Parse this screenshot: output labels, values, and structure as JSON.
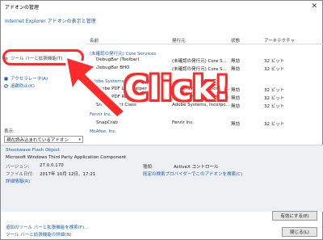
{
  "window": {
    "title": "アドオンの管理",
    "close_glyph": "✕"
  },
  "header": {
    "link": "Internet Explorer アドオンの表示と管理"
  },
  "sidebar": {
    "items": [
      {
        "label": "ツール バーと拡張機能(T)",
        "icon": "gear-icon"
      },
      {
        "label": "アクセラレータ(A)",
        "icon": "accelerator-icon"
      },
      {
        "label": "追跡防止(K)",
        "icon": "tracking-icon"
      }
    ],
    "show_label": "表示:",
    "show_value": "現在読み込まれているアドオン"
  },
  "list": {
    "columns": [
      "名前",
      "発行元",
      "状態",
      "アーキテクチャ"
    ],
    "groups": [
      {
        "name": "(未確認の発行元) Core Services"
      },
      {
        "name": "Adobe Systems, Incorporated"
      },
      {
        "name": "Fenrir Inc."
      },
      {
        "name": "McAfee, Inc."
      }
    ],
    "rows": [
      {
        "name": "DebugBar (Toolbar)",
        "publisher": "(未確認の発行元) Core S...",
        "status": "無効",
        "arch": "32 ビット"
      },
      {
        "name": "DebugBar BHO",
        "publisher": "(未確認の発行元) Core S...",
        "status": "無効",
        "arch": "32 ビット"
      },
      {
        "name": "Adobe PDF Link Helper",
        "publisher": "Adobe Systems, Incorpo...",
        "status": "無効",
        "arch": "32 ビット"
      },
      {
        "name": "Adobe PDF Reader",
        "publisher": "Adobe Systems, Incorpo...",
        "status": "無効",
        "arch": "32 ビット"
      },
      {
        "name": "SmartSelect Class",
        "publisher": "Adobe Systems, Incorpo...",
        "status": "無効",
        "arch": "32 ビット"
      },
      {
        "name": "SnapCrab",
        "publisher": "Fenrir Inc.",
        "status": "無効",
        "arch": "32 ビット"
      }
    ]
  },
  "details": {
    "name": "Shockwave Flash Object",
    "subtitle": "Microsoft Windows Third Party Application Component",
    "version_label": "バージョン:",
    "version": "27.0.0.170",
    "date_label": "ファイル日付:",
    "date": "2017年 10月 12日、17:21",
    "more": "詳細情報(R)",
    "type_label": "種類:",
    "type": "ActiveX コントロール",
    "search_link": "既定の検索プロバイダーでこのアドオンを検索(C)",
    "enable_button": "有効にする(E)"
  },
  "footer": {
    "link1": "追加のツール バーと拡張機能を検索(F)...",
    "link2": "ツール バーと拡張機能の詳細(N)",
    "close_button": "閉じる(L)"
  },
  "overlay": {
    "click_text": "Click!"
  },
  "colors": {
    "accent": "#ff2a2a",
    "link": "#1a5fb4"
  }
}
